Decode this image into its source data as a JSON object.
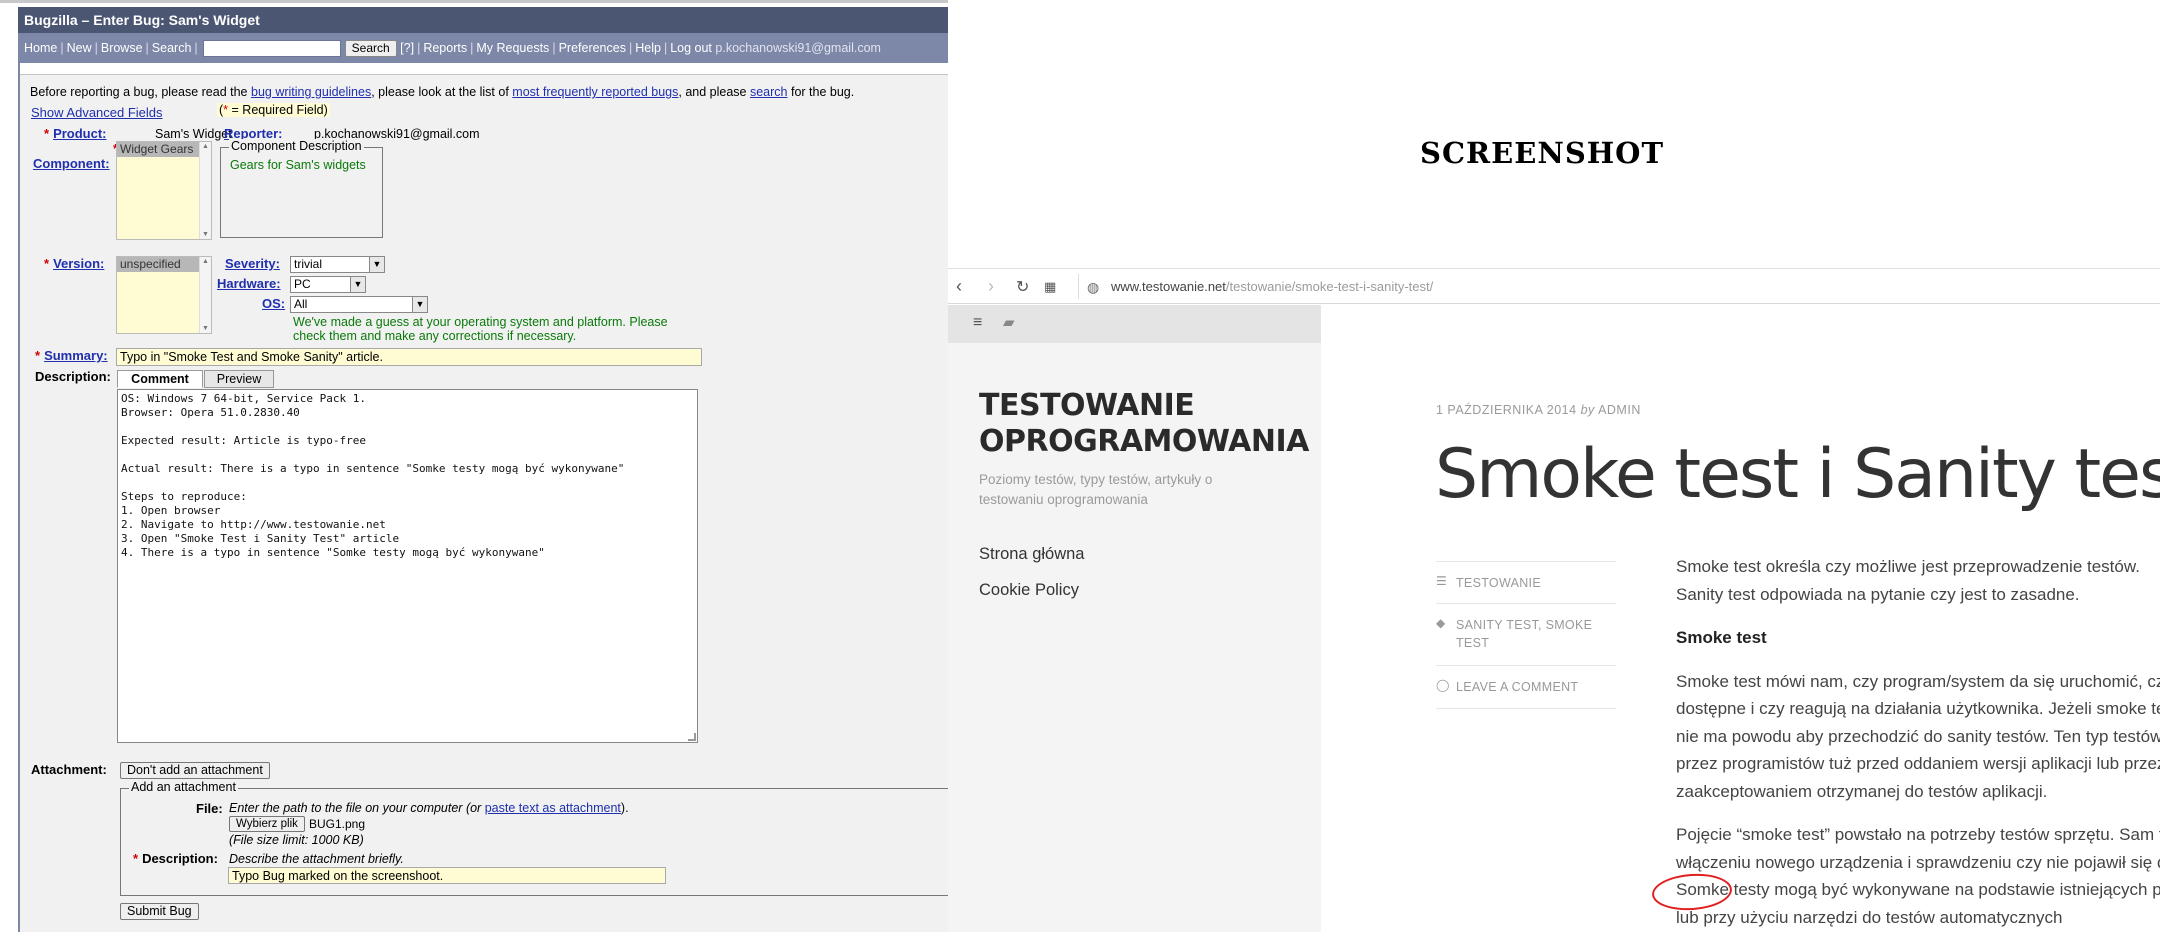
{
  "bugzilla": {
    "title": "Bugzilla – Enter Bug: Sam's Widget",
    "nav": {
      "items": [
        "Home",
        "New",
        "Browse",
        "Search"
      ],
      "search_button": "Search",
      "help_q": "[?]",
      "items2": [
        "Reports",
        "My Requests",
        "Preferences",
        "Help"
      ],
      "logout": "Log out",
      "user_email": "p.kochanowski91@gmail.com"
    },
    "intro": {
      "before": "Before reporting a bug, please read the",
      "link1": "bug writing guidelines",
      "middle": ", please look at the list of",
      "link2": "most frequently reported bugs",
      "and": ", and please",
      "link3": "search",
      "after": "for the bug."
    },
    "show_advanced": "Show Advanced Fields",
    "required_note_star": "*",
    "required_note": " = Required Field)",
    "required_note_open": "(",
    "product_label": "Product:",
    "product_value": "Sam's Widget",
    "reporter_label": "Reporter:",
    "reporter_value": "p.kochanowski91@gmail.com",
    "component_label": "Component:",
    "component_value": "Widget Gears",
    "component_desc_legend": "Component Description",
    "component_desc": "Gears for Sam's widgets",
    "version_label": "Version:",
    "version_value": "unspecified",
    "severity_label": "Severity:",
    "severity_value": "trivial",
    "hardware_label": "Hardware:",
    "hardware_value": "PC",
    "os_label": "OS:",
    "os_value": "All",
    "guess_note_1": "We've made a guess at your operating system and platform. Please",
    "guess_note_2": "check them and make any corrections if necessary.",
    "summary_label": "Summary:",
    "summary_value": "Typo in \"Smoke Test and Smoke Sanity\" article.",
    "description_label": "Description:",
    "tab_comment": "Comment",
    "tab_preview": "Preview",
    "description_lines": [
      "OS: Windows 7 64-bit, Service Pack 1.",
      "Browser: Opera 51.0.2830.40",
      "",
      "Expected result: Article is typo-free",
      "",
      "Actual result: There is a typo in sentence \"Somke testy mogą być wykonywane\"",
      "",
      "Steps to reproduce:",
      "1. Open browser",
      "2. Navigate to http://www.testowanie.net",
      "3. Open \"Smoke Test i Sanity Test\" article",
      "4. There is a typo in sentence \"Somke testy mogą być wykonywane\""
    ],
    "attachment_label": "Attachment:",
    "no_attachment_button": "Don't add an attachment",
    "add_attachment_legend": "Add an attachment",
    "file_label": "File:",
    "file_hint_before": "Enter the path to the file on your computer (or",
    "file_hint_link": "paste text as attachment",
    "file_hint_after": ").",
    "choose_file_button": "Wybierz plik",
    "file_name": "BUG1.png",
    "file_limit": "(File size limit: 1000 KB)",
    "att_desc_label": "Description:",
    "att_desc_hint": "Describe the attachment briefly.",
    "att_desc_value": "Typo Bug marked on the screenshoot.",
    "submit_button": "Submit Bug"
  },
  "screenshot": {
    "heading": "SCREENSHOT",
    "url_domain": "www.testowanie.net",
    "url_path": "/testowanie/smoke-test-i-sanity-test/",
    "site_title": "TESTOWANIE OPROGRAMOWANIA",
    "site_desc": "Poziomy testów, typy testów, artykuły o testowaniu oprogramowania",
    "menu": [
      "Strona główna",
      "Cookie Policy"
    ],
    "post_date": "1 PAŹDZIERNIKA 2014",
    "post_by": "by",
    "post_author": "ADMIN",
    "post_title": "Smoke test i Sanity test",
    "meta_category": "TESTOWANIE",
    "meta_tags": "SANITY TEST, SMOKE TEST",
    "meta_comment": "LEAVE A COMMENT",
    "body": {
      "p1_l1": "Smoke test określa czy możliwe jest przeprowadzenie testów.",
      "p1_l2": "Sanity test odpowiada na pytanie czy jest to zasadne.",
      "h1": "Smoke test",
      "p2_l1": "Smoke test mówi nam, czy program/system da się uruchomić, czy",
      "p2_l2": "dostępne i czy reagują na działania użytkownika. Jeżeli smoke te",
      "p2_l3": "nie ma powodu aby przechodzić do sanity testów. Ten typ testów",
      "p2_l4": "przez programistów tuż przed oddaniem wersji aplikacji lub przez",
      "p2_l5": "zaakceptowaniem otrzymanej do testów aplikacji.",
      "p3_l1": "Pojęcie “smoke test” powstało na potrzeby testów sprzętu. Sam t",
      "p3_l2": "włączeniu nowego urządzenia i sprawdzeniu czy nie pojawił się d",
      "p3_l3": "Somke testy mogą być wykonywane na podstawie istniejących p",
      "p3_l4": "lub przy użyciu narzędzi do testów automatycznych"
    }
  },
  "colors": {
    "bz_title_bg": "#4b5673",
    "bz_nav_bg": "#7d88a8",
    "required": "#cc0000",
    "link": "#1f2fae",
    "annotation": "#e21e1e"
  }
}
